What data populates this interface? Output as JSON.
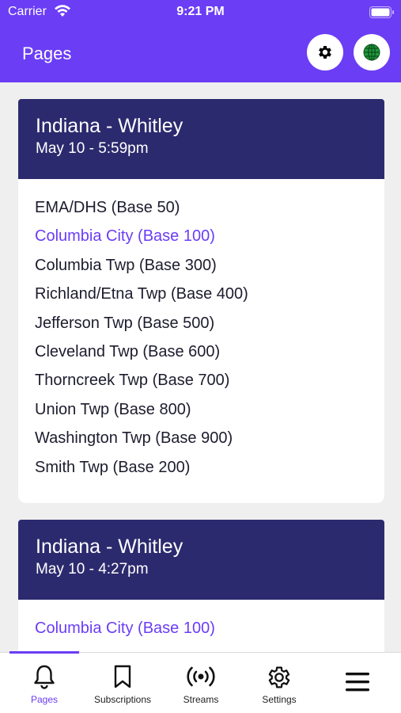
{
  "status": {
    "carrier": "Carrier",
    "time": "9:21 PM"
  },
  "header": {
    "title": "Pages",
    "accent_color": "#6b3df5"
  },
  "cards": [
    {
      "title": "Indiana - Whitley",
      "date": "May 10 - 5:59pm",
      "items": [
        "EMA/DHS (Base 50)",
        "Columbia City (Base 100)",
        "Columbia Twp (Base 300)",
        "Richland/Etna Twp (Base 400)",
        "Jefferson Twp (Base 500)",
        "Cleveland Twp (Base 600)",
        "Thorncreek Twp (Base 700)",
        "Union Twp (Base 800)",
        "Washington Twp (Base 900)",
        "Smith Twp (Base 200)"
      ]
    },
    {
      "title": "Indiana - Whitley",
      "date": "May 10 - 4:27pm",
      "items": [
        "Columbia City (Base 100)"
      ]
    }
  ],
  "tabs": [
    {
      "label": "Pages",
      "icon": "bell-icon",
      "active": true
    },
    {
      "label": "Subscriptions",
      "icon": "bookmark-icon"
    },
    {
      "label": "Streams",
      "icon": "broadcast-icon"
    },
    {
      "label": "Settings",
      "icon": "gear-icon"
    },
    {
      "label": "",
      "icon": "menu-icon"
    }
  ]
}
